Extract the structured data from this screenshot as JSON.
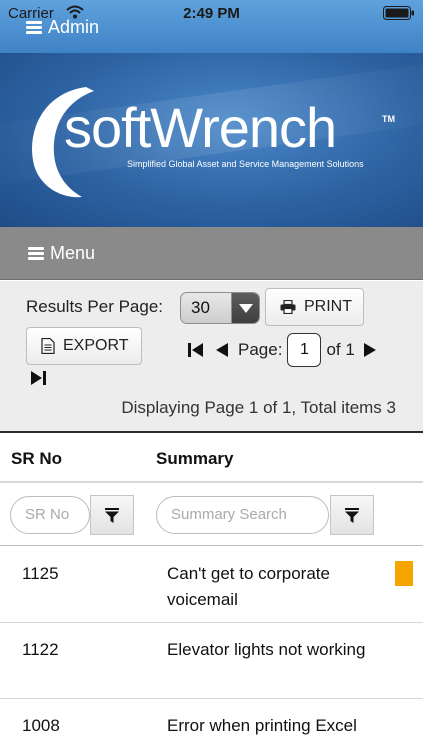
{
  "status_bar": {
    "carrier": "Carrier",
    "time": "2:49 PM",
    "icons": [
      "wifi-icon",
      "battery-icon"
    ]
  },
  "admin": {
    "label": "Admin",
    "icon": "hamburger-icon"
  },
  "banner": {
    "logo_text": "softWrench",
    "trademark": "TM",
    "tagline": "Simplified Global Asset and Service Management Solutions",
    "colors": {
      "top_bar": "#4a90d4",
      "banner": "#2d63a3"
    }
  },
  "menu": {
    "label": "Menu",
    "icon": "hamburger-icon"
  },
  "controls": {
    "results_per_page_label": "Results Per Page:",
    "results_per_page_value": "30",
    "print_label": "PRINT",
    "export_label": "EXPORT",
    "page_label": "Page:",
    "page_value": "1",
    "page_of": "of 1",
    "displaying": "Displaying Page 1 of 1, Total items 3"
  },
  "table": {
    "columns": [
      {
        "label": "SR No",
        "filter_placeholder": "SR No"
      },
      {
        "label": "Summary",
        "filter_placeholder": "Summary Search"
      }
    ],
    "rows": [
      {
        "sr_no": "1125",
        "summary": "Can't get to corporate voicemail",
        "flag_color": "#f5a400"
      },
      {
        "sr_no": "1122",
        "summary": "Elevator lights not working"
      },
      {
        "sr_no": "1008",
        "summary": "Error when printing Excel"
      }
    ]
  }
}
